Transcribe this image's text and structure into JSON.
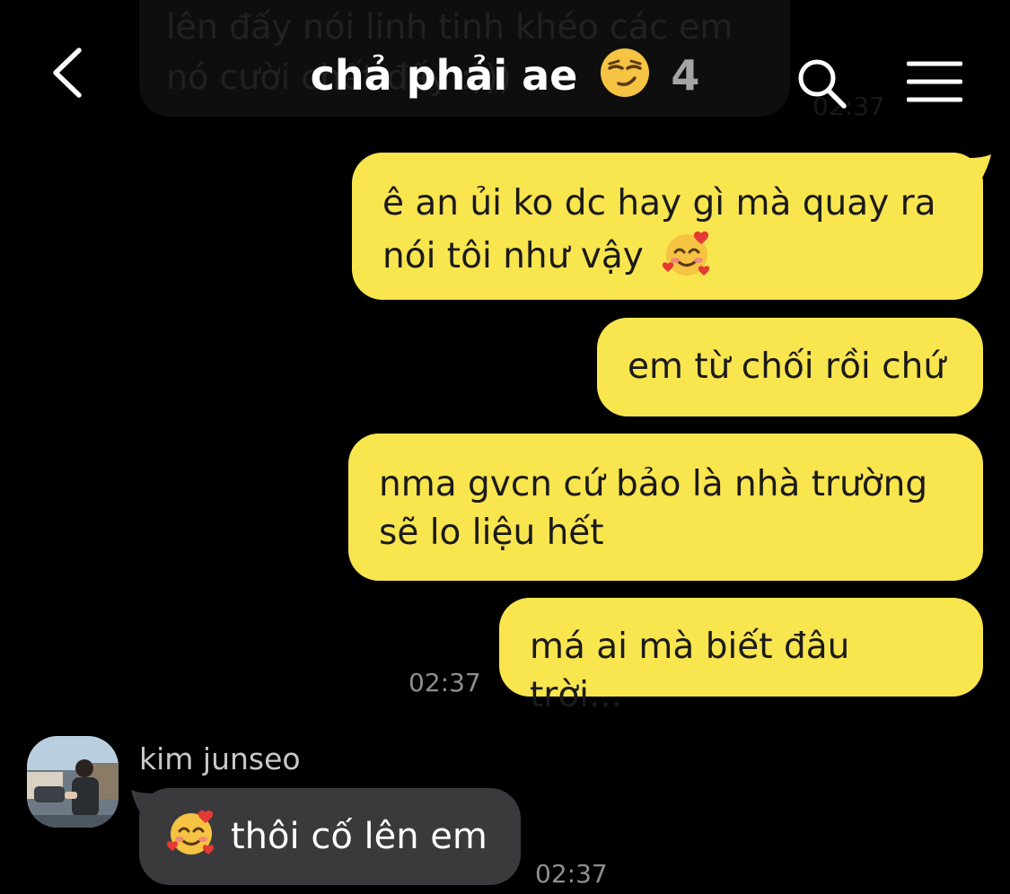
{
  "header": {
    "title": "chả phải ae",
    "title_emoji": "smirking-face",
    "member_count": "4"
  },
  "previous_message": {
    "text": "lên đấy nói linh tinh khéo các em\nnó cười chết đấy :)))",
    "time": "02:37"
  },
  "messages_out": [
    {
      "text": "ê an ủi ko dc hay gì mà quay ra nói tôi như vậy",
      "emoji": "smiling-face-with-hearts"
    },
    {
      "text": "em từ chối rồi chứ"
    },
    {
      "text": "nma gvcn cứ bảo là nhà trường sẽ lo liệu hết"
    },
    {
      "text": "má ai mà biết đâu trời...",
      "time": "02:37"
    }
  ],
  "message_in": {
    "sender": "kim junseo",
    "emoji": "smiling-face-with-hearts",
    "text": "thôi cố lên em",
    "time": "02:37"
  },
  "colors": {
    "background": "#000000",
    "outgoing_bubble": "#f9e54e",
    "incoming_bubble": "#3a3a3c",
    "timestamp": "#8e8e8e"
  }
}
